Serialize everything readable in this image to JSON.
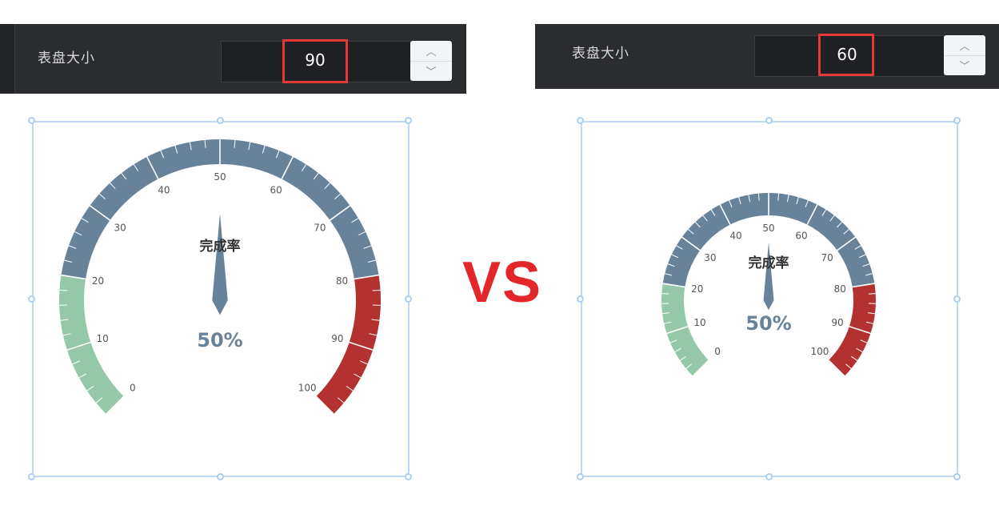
{
  "comparison_text": "VS",
  "colors": {
    "accent_red": "#e53935",
    "gauge_blue": "#688299",
    "gauge_green": "#95c8a8",
    "gauge_red": "#b33230",
    "frame": "#bcd9f5"
  },
  "left": {
    "property_label": "表盘大小",
    "dial_size_value": "90",
    "stepper": {
      "up_icon": "chevron-up-icon",
      "down_icon": "chevron-down-icon"
    },
    "gauge": {
      "title": "完成率",
      "value_text": "50%",
      "value": 50,
      "min": 0,
      "max": 100,
      "tick_labels": [
        "0",
        "10",
        "20",
        "30",
        "40",
        "50",
        "60",
        "70",
        "80",
        "90",
        "100"
      ]
    }
  },
  "right": {
    "property_label": "表盘大小",
    "dial_size_value": "60",
    "stepper": {
      "up_icon": "chevron-up-icon",
      "down_icon": "chevron-down-icon"
    },
    "gauge": {
      "title": "完成率",
      "value_text": "50%",
      "value": 50,
      "min": 0,
      "max": 100,
      "tick_labels": [
        "0",
        "10",
        "20",
        "30",
        "40",
        "50",
        "60",
        "70",
        "80",
        "90",
        "100"
      ]
    }
  }
}
